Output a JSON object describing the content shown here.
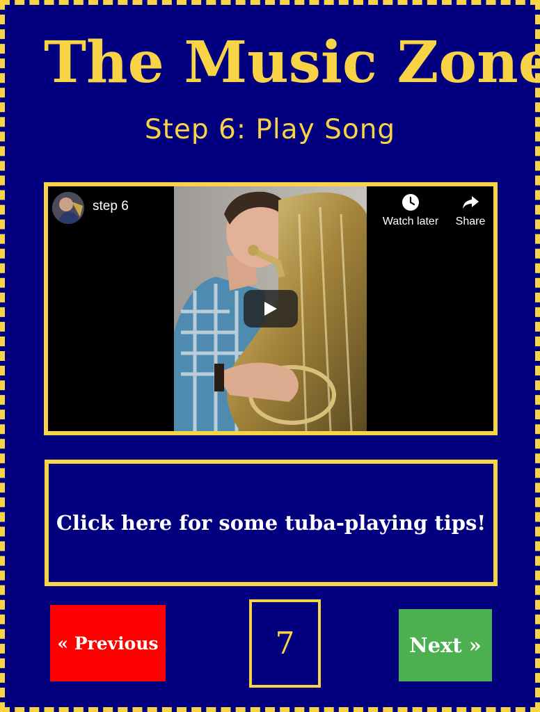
{
  "header": {
    "title": "The Music Zone",
    "subtitle": "Step 6: Play Song"
  },
  "video": {
    "title": "step 6",
    "watch_later_label": "Watch later",
    "share_label": "Share",
    "icons": [
      "clock-icon",
      "share-icon",
      "play-icon"
    ]
  },
  "tips": {
    "label": "Click here for some tuba-playing tips!"
  },
  "nav": {
    "previous_label": "« Previous",
    "page_number": "7",
    "next_label": "Next »"
  },
  "colors": {
    "background": "#030080",
    "accent": "#f8d346",
    "previous": "#fe0000",
    "next": "#4caf50"
  }
}
